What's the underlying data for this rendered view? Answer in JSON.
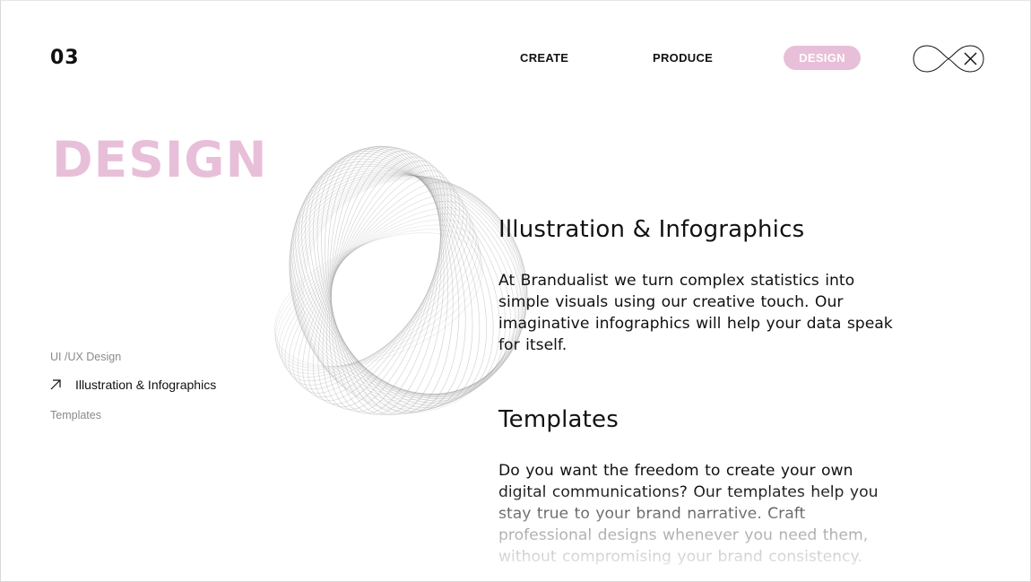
{
  "header": {
    "section_number": "03",
    "nav": [
      {
        "label": "CREATE",
        "active": false
      },
      {
        "label": "PRODUCE",
        "active": false
      },
      {
        "label": "DESIGN",
        "active": true
      }
    ],
    "logo_icon": "brand-infinity-close-icon"
  },
  "hero": {
    "title": "DESIGN",
    "decor_icon": "spirograph-ring-icon"
  },
  "side_nav": {
    "items": [
      {
        "label": "UI /UX Design",
        "active": false
      },
      {
        "label": "Illustration & Infographics",
        "active": true,
        "icon": "arrow-up-right-icon"
      },
      {
        "label": "Templates",
        "active": false
      }
    ]
  },
  "sections": [
    {
      "title": "Illustration & Infographics",
      "body": "At Brandualist we turn complex statistics into simple visuals using our creative touch. Our imaginative infographics will help your data speak for itself."
    },
    {
      "title": "Templates",
      "body": "Do you want the freedom to create your own digital communications? Our templates help you stay true to your brand narrative. Craft professional designs whenever you need them, without compromising your brand consistency."
    }
  ],
  "colors": {
    "accent_pink": "#e8bfd8",
    "text": "#111111",
    "muted": "#8a8a8a"
  }
}
